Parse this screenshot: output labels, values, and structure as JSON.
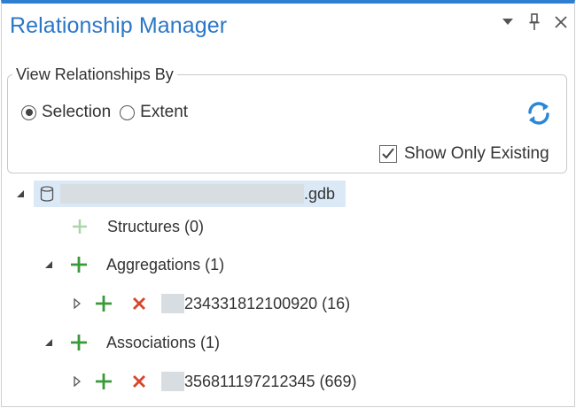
{
  "panel": {
    "title": "Relationship Manager",
    "controls": [
      "dropdown-icon",
      "pin-icon",
      "close-icon"
    ]
  },
  "view_by": {
    "legend": "View Relationships By",
    "options": [
      {
        "label": "Selection",
        "selected": true
      },
      {
        "label": "Extent",
        "selected": false
      }
    ],
    "refresh_icon": "refresh-icon",
    "show_only_existing": {
      "label": "Show Only Existing",
      "checked": true
    }
  },
  "tree": {
    "root": {
      "suffix": ".gdb",
      "expanded": true,
      "icon": "database-icon"
    },
    "structures": {
      "label": "Structures (0)"
    },
    "aggregations": {
      "label": "Aggregations (1)",
      "expanded": true,
      "item": {
        "label": "234331812100920 (16)",
        "expanded": false
      }
    },
    "associations": {
      "label": "Associations (1)",
      "expanded": true,
      "item": {
        "label": "356811197212345 (669)",
        "expanded": false
      }
    }
  },
  "colors": {
    "accent": "#2a77c7",
    "add_green": "#3a9a3a",
    "add_green_disabled": "#a8d4a8",
    "delete_red": "#d9452b",
    "selection_bg": "#dbe9f7"
  }
}
